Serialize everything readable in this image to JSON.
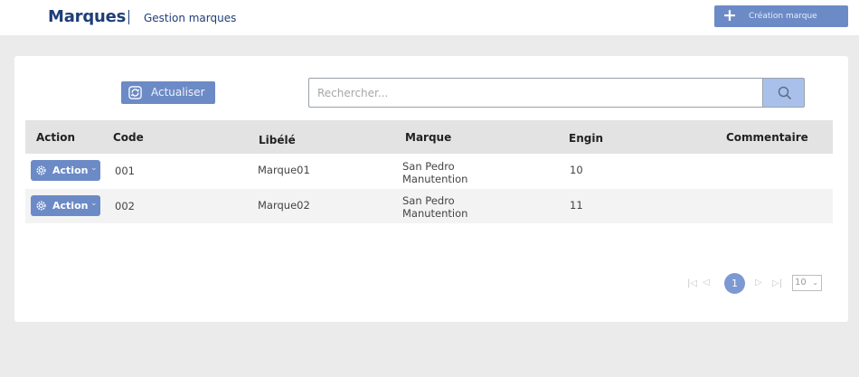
{
  "header": {
    "title": "Marques",
    "subtitle": "Gestion marques",
    "create_button_label": "Création marque"
  },
  "toolbar": {
    "refresh_label": "Actualiser",
    "search_placeholder": "Rechercher..."
  },
  "table": {
    "columns": [
      "Action",
      "Code",
      "Libélé",
      "Marque",
      "Engin",
      "Commentaire"
    ],
    "rows": [
      {
        "action_label": "Action",
        "code": "001",
        "libelle": "Marque01",
        "marque_line1": "San Pedro",
        "marque_line2": "Manutention",
        "engin": "10",
        "commentaire": ""
      },
      {
        "action_label": "Action",
        "code": "002",
        "libelle": "Marque02",
        "marque_line1": "San Pedro",
        "marque_line2": "Manutention",
        "engin": "11",
        "commentaire": ""
      }
    ]
  },
  "pagination": {
    "current_page": "1",
    "page_size": "10",
    "icons": [
      "first-page-icon",
      "prev-page-icon",
      "next-page-icon",
      "last-page-icon"
    ]
  },
  "colors": {
    "brand": "#1f3e78",
    "button": "#6c8ac6",
    "search_button": "#a9c1ea",
    "header_row": "#e3e3e3",
    "background": "#ebebeb"
  }
}
